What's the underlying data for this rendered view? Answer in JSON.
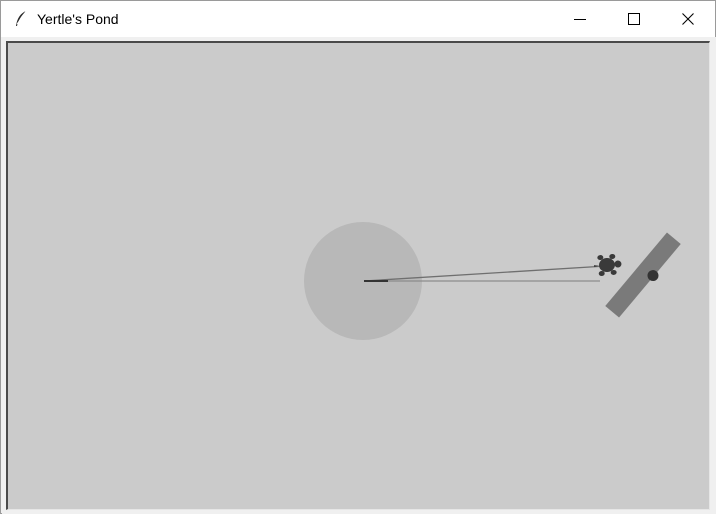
{
  "window": {
    "title": "Yertle's Pond",
    "app_icon": "feather-icon",
    "controls": {
      "minimize_icon": "minimize-icon",
      "maximize_icon": "maximize-icon",
      "close_icon": "close-icon"
    }
  },
  "canvas": {
    "background": "#cbcbcb",
    "colors": {
      "pond": "#b8b8b8",
      "turtle": "#3a3a3a",
      "paddle": "#7a7a7a",
      "paddle_dot": "#333333",
      "line": "#777777"
    }
  }
}
